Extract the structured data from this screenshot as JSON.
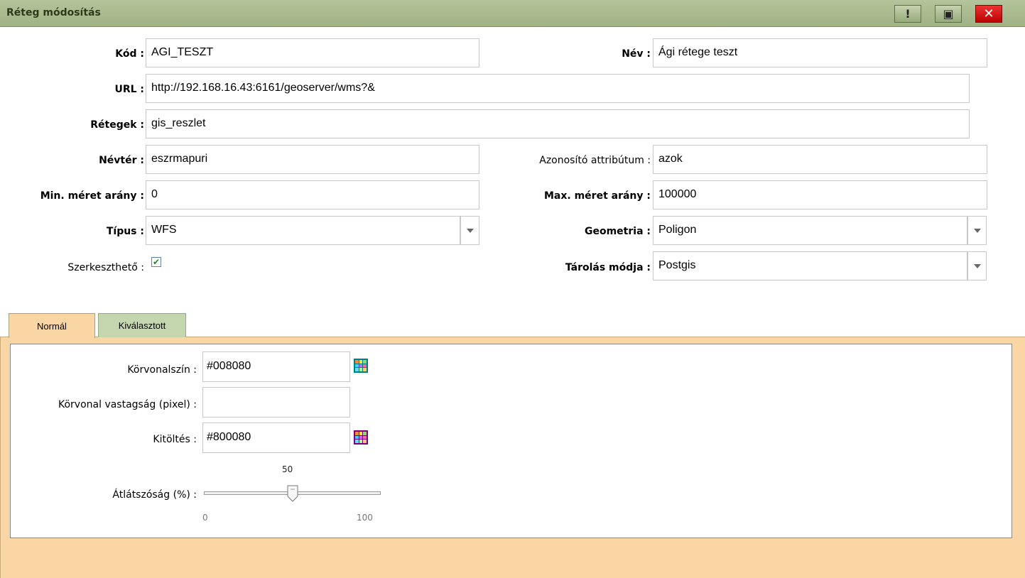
{
  "window": {
    "title": "Réteg módosítás",
    "btn_info": "!",
    "btn_save": "▣",
    "btn_close": "✕"
  },
  "form": {
    "kod_label": "Kód :",
    "kod_value": "AGI_TESZT",
    "nev_label": "Név :",
    "nev_value": "Ági rétege teszt",
    "url_label": "URL :",
    "url_value": "http://192.168.16.43:6161/geoserver/wms?&",
    "retegek_label": "Rétegek :",
    "retegek_value": "gis_reszlet",
    "nevter_label": "Névtér :",
    "nevter_value": "eszrmapuri",
    "azon_label": "Azonosító attribútum :",
    "azon_value": "azok",
    "min_label": "Min. méret arány :",
    "min_value": "0",
    "max_label": "Max. méret arány :",
    "max_value": "100000",
    "tipus_label": "Típus :",
    "tipus_value": "WFS",
    "geom_label": "Geometria :",
    "geom_value": "Poligon",
    "szerk_label": "Szerkeszthető :",
    "szerk_checked": "✔",
    "tarolas_label": "Tárolás módja :",
    "tarolas_value": "Postgis"
  },
  "tabs": [
    {
      "label": "Normál",
      "active": true
    },
    {
      "label": "Kiválasztott",
      "active": false
    }
  ],
  "style": {
    "korvonalszin_label": "Körvonalszín :",
    "korvonalszin_value": "#008080",
    "korvonalszin_icon_color": "#008080",
    "vastagsag_label": "Körvonal vastagság (pixel) :",
    "vastagsag_value": "",
    "kitoltes_label": "Kitöltés :",
    "kitoltes_value": "#800080",
    "kitoltes_icon_color": "#800080",
    "atlatszosag_label": "Átlátszóság (%) :",
    "atlatszosag_value": "50",
    "slider_min": "0",
    "slider_max": "100",
    "slider_fraction": 0.5
  },
  "icons": {
    "color_picker": "color-grid-icon",
    "dropdown": "chevron-down-icon",
    "checkbox": "check-icon"
  },
  "colors": {
    "titlebar": "#a9bb8e",
    "panel": "#fad6a5",
    "tab_inactive": "#c4d6ae"
  }
}
